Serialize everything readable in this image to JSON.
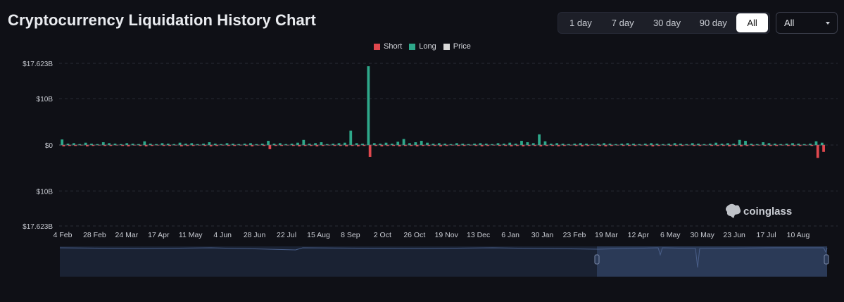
{
  "header": {
    "title": "Cryptocurrency Liquidation History Chart",
    "ranges": [
      "1 day",
      "7 day",
      "30 day",
      "90 day",
      "All"
    ],
    "active_range": "All",
    "coin_select": "All"
  },
  "legend": [
    {
      "label": "Short",
      "color": "#e0484e"
    },
    {
      "label": "Long",
      "color": "#2ea88a"
    },
    {
      "label": "Price",
      "color": "#d9d9d9"
    }
  ],
  "watermark": "coinglass",
  "chart_data": {
    "type": "bar",
    "y_tick_labels": [
      "$17.623B",
      "$10B",
      "$0",
      "$10B",
      "$17.623B"
    ],
    "x_tick_labels": [
      "4 Feb",
      "28 Feb",
      "24 Mar",
      "17 Apr",
      "11 May",
      "4 Jun",
      "28 Jun",
      "22 Jul",
      "15 Aug",
      "8 Sep",
      "2 Oct",
      "26 Oct",
      "19 Nov",
      "13 Dec",
      "6 Jan",
      "30 Jan",
      "23 Feb",
      "19 Mar",
      "12 Apr",
      "6 May",
      "30 May",
      "23 Jun",
      "17 Jul",
      "10 Aug"
    ],
    "ylim": [
      -17.623,
      17.623
    ],
    "grid": true,
    "legend_position": "top-center",
    "series": [
      {
        "name": "Long",
        "color": "#2ea88a",
        "values": [
          1.2,
          0.3,
          0.4,
          0.2,
          0.5,
          0.3,
          0.2,
          0.6,
          0.4,
          0.3,
          0.2,
          0.4,
          0.3,
          0.2,
          0.8,
          0.3,
          0.2,
          0.4,
          0.3,
          0.2,
          0.5,
          0.3,
          0.4,
          0.2,
          0.3,
          0.6,
          0.3,
          0.2,
          0.4,
          0.3,
          0.2,
          0.3,
          0.4,
          0.2,
          0.3,
          0.9,
          0.3,
          0.4,
          0.2,
          0.3,
          0.5,
          1.1,
          0.3,
          0.4,
          0.6,
          0.2,
          0.3,
          0.4,
          0.5,
          3.1,
          0.4,
          0.3,
          17.0,
          0.4,
          0.3,
          0.5,
          0.3,
          0.7,
          1.3,
          0.4,
          0.6,
          0.9,
          0.5,
          0.3,
          0.4,
          0.3,
          0.2,
          0.4,
          0.3,
          0.2,
          0.3,
          0.4,
          0.3,
          0.2,
          0.4,
          0.3,
          0.5,
          0.3,
          0.9,
          0.6,
          0.4,
          2.3,
          0.8,
          0.3,
          0.4,
          0.3,
          0.2,
          0.3,
          0.4,
          0.3,
          0.2,
          0.3,
          0.4,
          0.3,
          0.2,
          0.3,
          0.4,
          0.3,
          0.2,
          0.3,
          0.4,
          0.3,
          0.2,
          0.3,
          0.4,
          0.3,
          0.2,
          0.4,
          0.3,
          0.2,
          0.3,
          0.5,
          0.3,
          0.4,
          0.3,
          1.1,
          0.9,
          0.3,
          0.2,
          0.6,
          0.4,
          0.3,
          0.2,
          0.3,
          0.4,
          0.3,
          0.2,
          0.3,
          0.8,
          0.5
        ]
      },
      {
        "name": "Short",
        "color": "#e0484e",
        "values": [
          0.3,
          0.2,
          0.2,
          0.1,
          0.3,
          0.2,
          0.1,
          0.2,
          0.2,
          0.1,
          0.2,
          0.3,
          0.1,
          0.2,
          0.3,
          0.2,
          0.1,
          0.2,
          0.2,
          0.1,
          0.3,
          0.2,
          0.2,
          0.1,
          0.2,
          0.3,
          0.2,
          0.1,
          0.2,
          0.2,
          0.1,
          0.2,
          0.3,
          0.1,
          0.2,
          0.9,
          0.2,
          0.2,
          0.1,
          0.2,
          0.3,
          0.2,
          0.2,
          0.3,
          0.2,
          0.1,
          0.2,
          0.2,
          0.3,
          0.2,
          0.3,
          0.2,
          2.6,
          0.2,
          0.3,
          0.2,
          0.2,
          0.3,
          0.2,
          0.2,
          0.3,
          0.2,
          0.2,
          0.2,
          0.3,
          0.2,
          0.1,
          0.2,
          0.2,
          0.1,
          0.2,
          0.3,
          0.2,
          0.1,
          0.2,
          0.2,
          0.3,
          0.2,
          0.3,
          0.2,
          0.2,
          0.3,
          0.2,
          0.2,
          0.3,
          0.2,
          0.1,
          0.2,
          0.3,
          0.2,
          0.1,
          0.2,
          0.3,
          0.2,
          0.1,
          0.2,
          0.2,
          0.2,
          0.1,
          0.2,
          0.3,
          0.2,
          0.1,
          0.2,
          0.2,
          0.2,
          0.1,
          0.2,
          0.2,
          0.1,
          0.2,
          0.2,
          0.2,
          0.3,
          0.2,
          0.3,
          0.2,
          0.2,
          0.1,
          0.2,
          0.2,
          0.2,
          0.1,
          0.2,
          0.2,
          0.2,
          0.1,
          0.2,
          2.8,
          1.5
        ]
      }
    ]
  }
}
